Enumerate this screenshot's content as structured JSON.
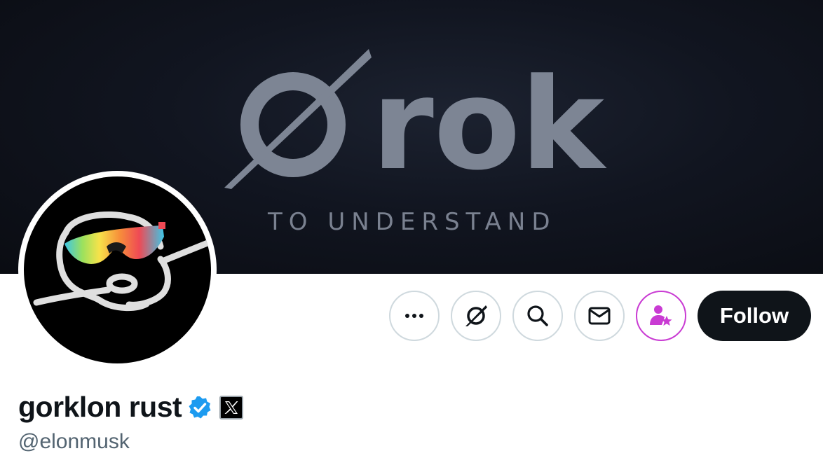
{
  "banner": {
    "wordmark": "rok",
    "tagline": "TO UNDERSTAND"
  },
  "profile": {
    "display_name": "gorklon rust",
    "handle": "@elonmusk",
    "verified_color": "#1d9bf0",
    "affiliate_icon": "x-logo-icon"
  },
  "actions": {
    "more_icon": "more-horizontal-icon",
    "grok_icon": "grok-icon",
    "search_icon": "search-icon",
    "message_icon": "mail-icon",
    "subscribe_icon": "subscribe-person-star-icon",
    "subscribe_color": "#c93bd3",
    "follow_label": "Follow"
  }
}
